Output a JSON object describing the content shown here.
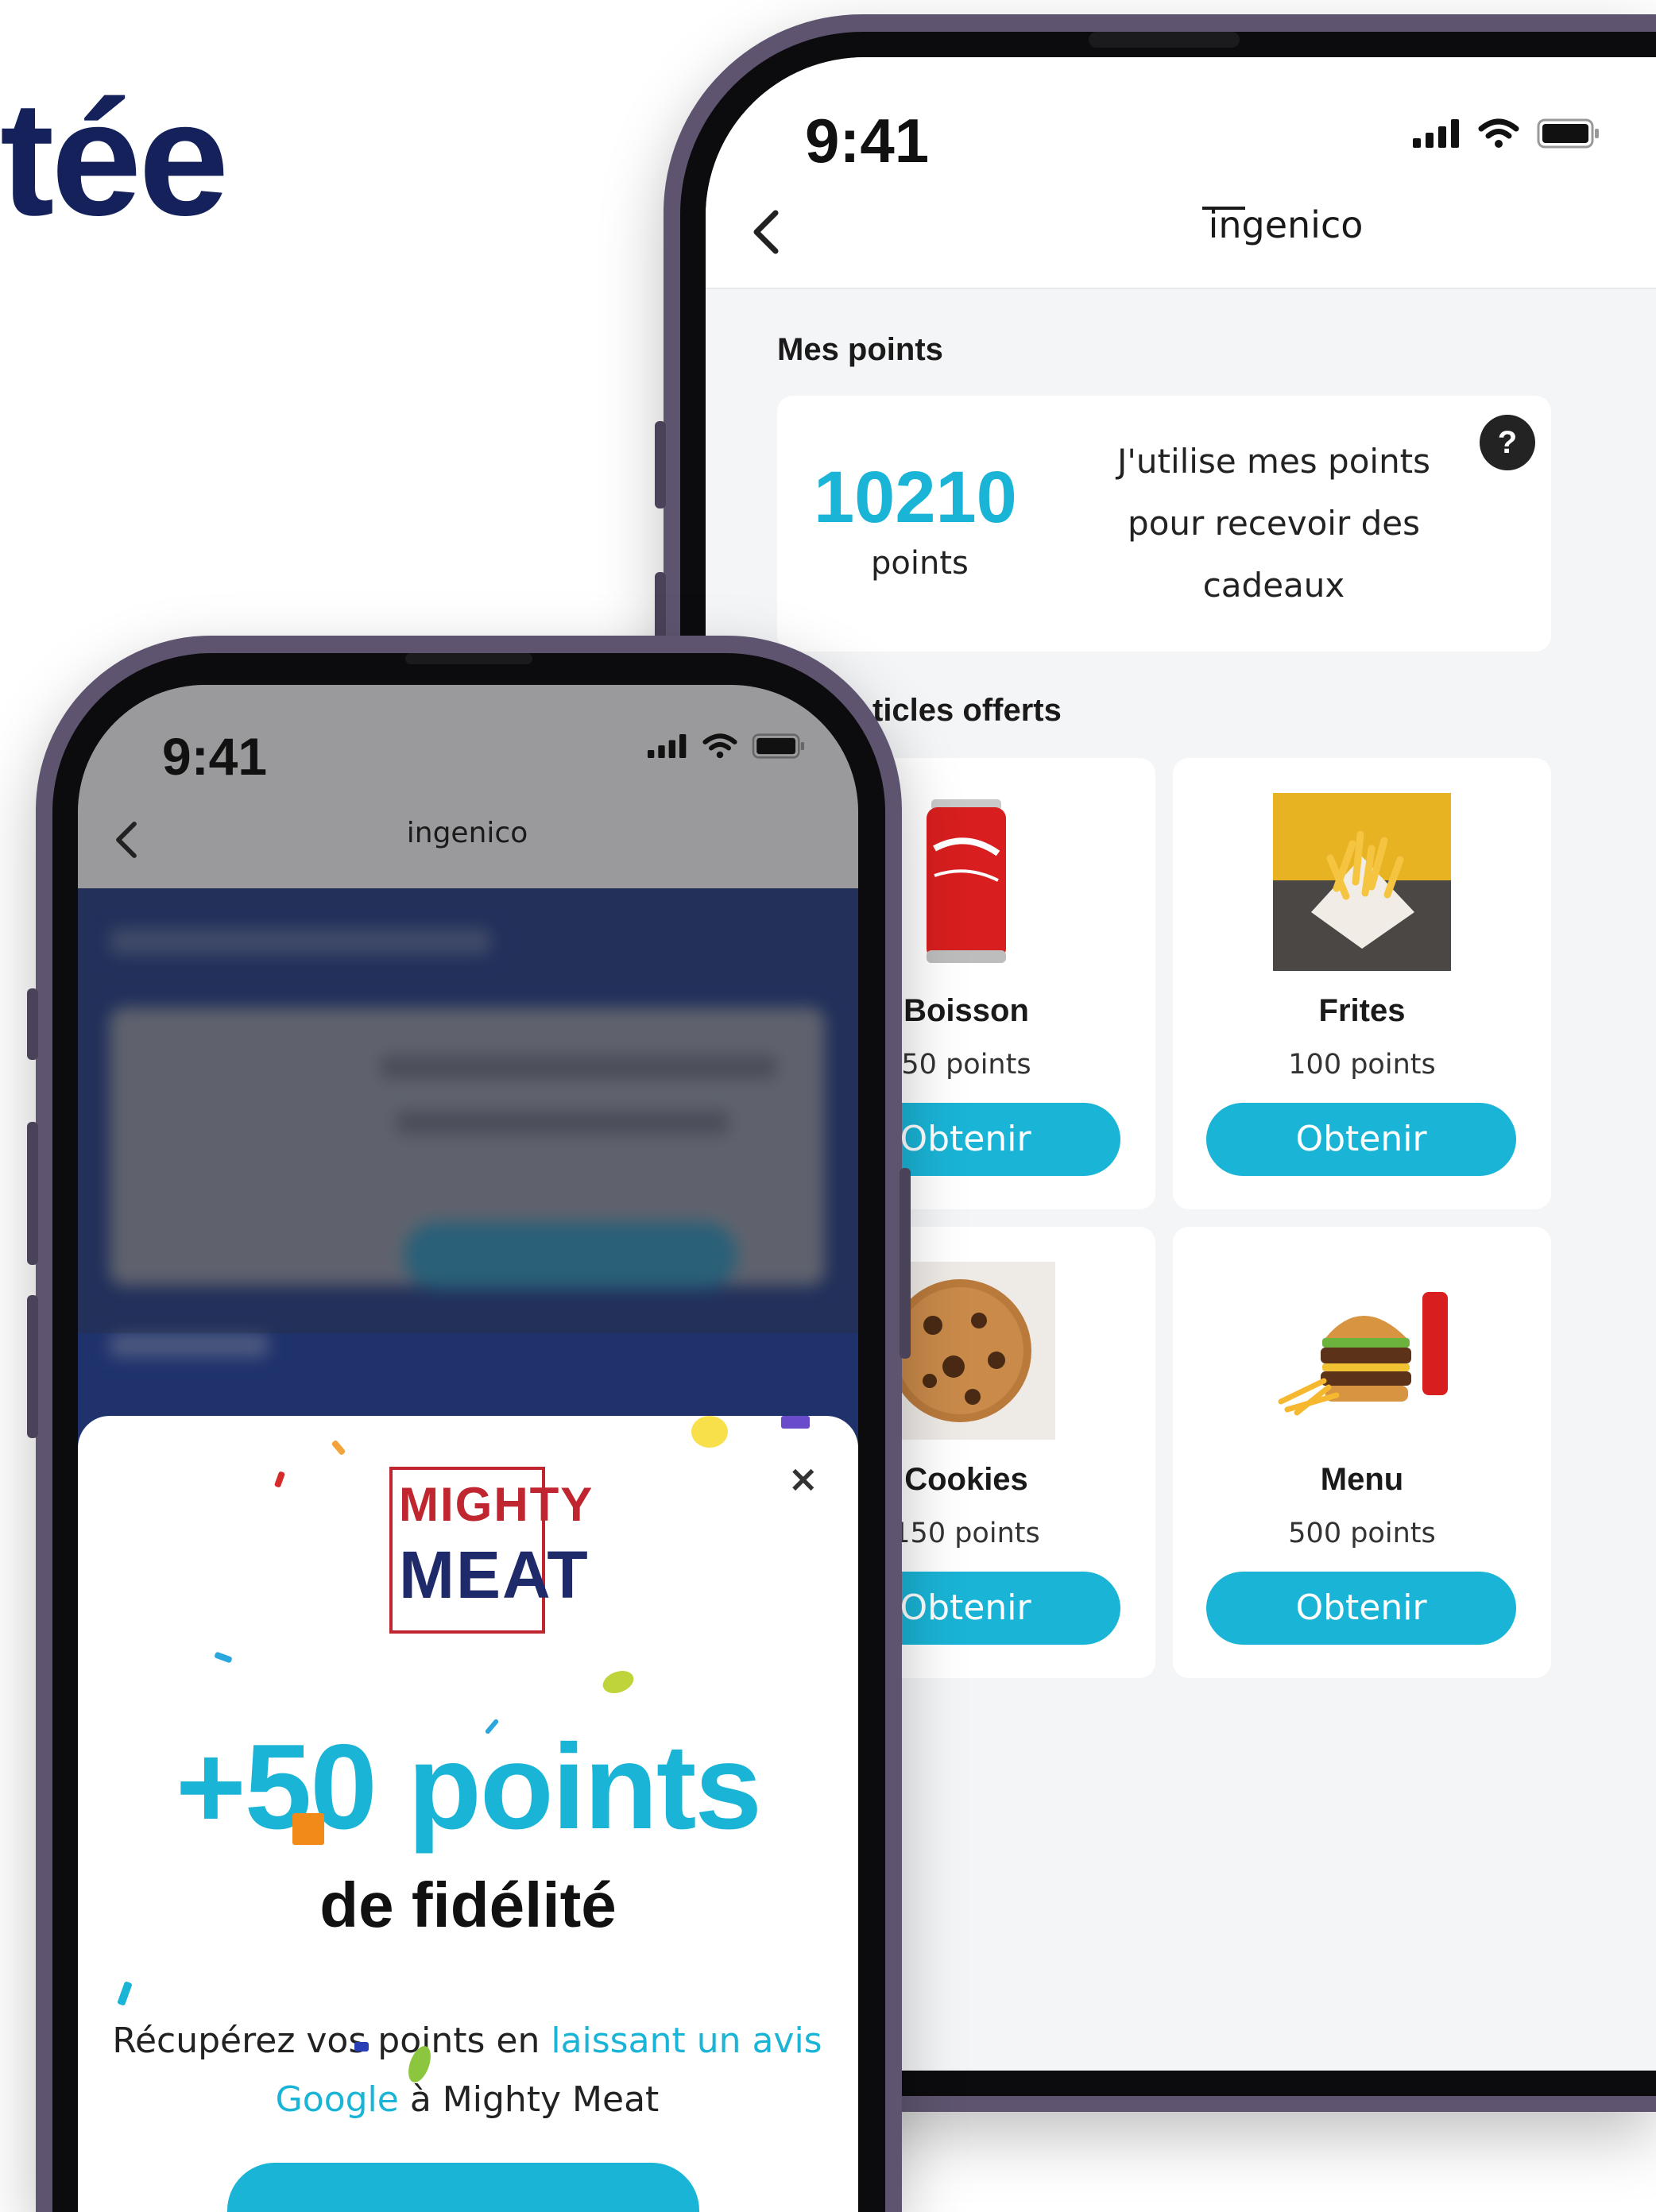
{
  "headline": "tée",
  "back_phone": {
    "time": "9:41",
    "brand": "ingenico",
    "section_points": "Mes points",
    "points_value": "10210",
    "points_unit": "points",
    "points_cta_text": "J'utilise mes points pour recevoir des cadeaux",
    "help_label": "?",
    "section_rewards": "ticles offerts",
    "rewards": [
      {
        "name": "Boisson",
        "cost": "50 points",
        "button": "Obtenir",
        "icon": "soda-can-icon"
      },
      {
        "name": "Frites",
        "cost": "100 points",
        "button": "Obtenir",
        "icon": "fries-icon"
      },
      {
        "name": "Cookies",
        "cost": "150 points",
        "button": "Obtenir",
        "icon": "cookie-icon"
      },
      {
        "name": "Menu",
        "cost": "500 points",
        "button": "Obtenir",
        "icon": "burger-menu-icon"
      }
    ]
  },
  "front_phone": {
    "time": "9:41",
    "brand": "ingenico",
    "modal": {
      "close_label": "×",
      "logo_line1": "MIGHTY",
      "logo_line2": "MEAT",
      "bonus_title": "+50 points",
      "bonus_subtitle": "de fidélité",
      "message_prefix": "Récupérez vos points en ",
      "message_link": "laissant un avis Google",
      "message_suffix": " à Mighty Meat"
    }
  },
  "colors": {
    "accent": "#1ab4d6",
    "navy": "#14215b",
    "frame": "#5e5470",
    "logo_red": "#c0262f"
  }
}
